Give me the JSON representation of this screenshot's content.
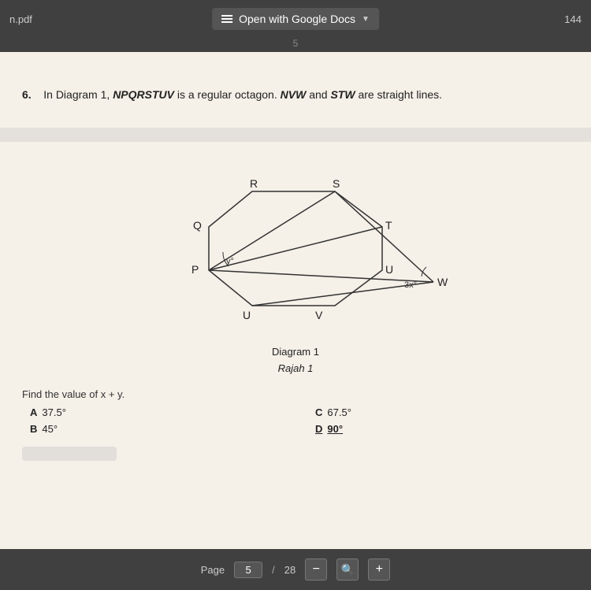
{
  "topbar": {
    "file_label": "n.pdf",
    "open_button_label": "Open with Google Docs",
    "page_right": "144"
  },
  "page_number_top": "5",
  "question": {
    "number": "6.",
    "text": "In Diagram 1,",
    "octagon_label": "NPQRSTUV",
    "octagon_desc": "is a regular octagon.",
    "line1": "NVW",
    "line1_desc": "and",
    "line2": "STW",
    "line2_desc": "are straight lines."
  },
  "diagram": {
    "caption_line1": "Diagram 1",
    "caption_line2": "Rajah 1",
    "labels": {
      "R": "R",
      "S": "S",
      "T": "T",
      "Q": "Q",
      "P": "P",
      "U_top": "U",
      "U_bot": "U",
      "V": "V",
      "W": "W",
      "angle_y": "y°",
      "angle_3x": "3x°"
    }
  },
  "find_text": "Find the value of x + y.",
  "answers": [
    {
      "letter": "A",
      "value": "37.5°",
      "bold": false
    },
    {
      "letter": "C",
      "value": "67.5°",
      "bold": false
    },
    {
      "letter": "B",
      "value": "45°",
      "bold": false
    },
    {
      "letter": "D",
      "value": "90°",
      "bold": true
    }
  ],
  "bottom_bar": {
    "page_label": "Page",
    "current_page": "5",
    "separator": "/",
    "total_pages": "28",
    "minus_label": "−",
    "plus_label": "+"
  }
}
